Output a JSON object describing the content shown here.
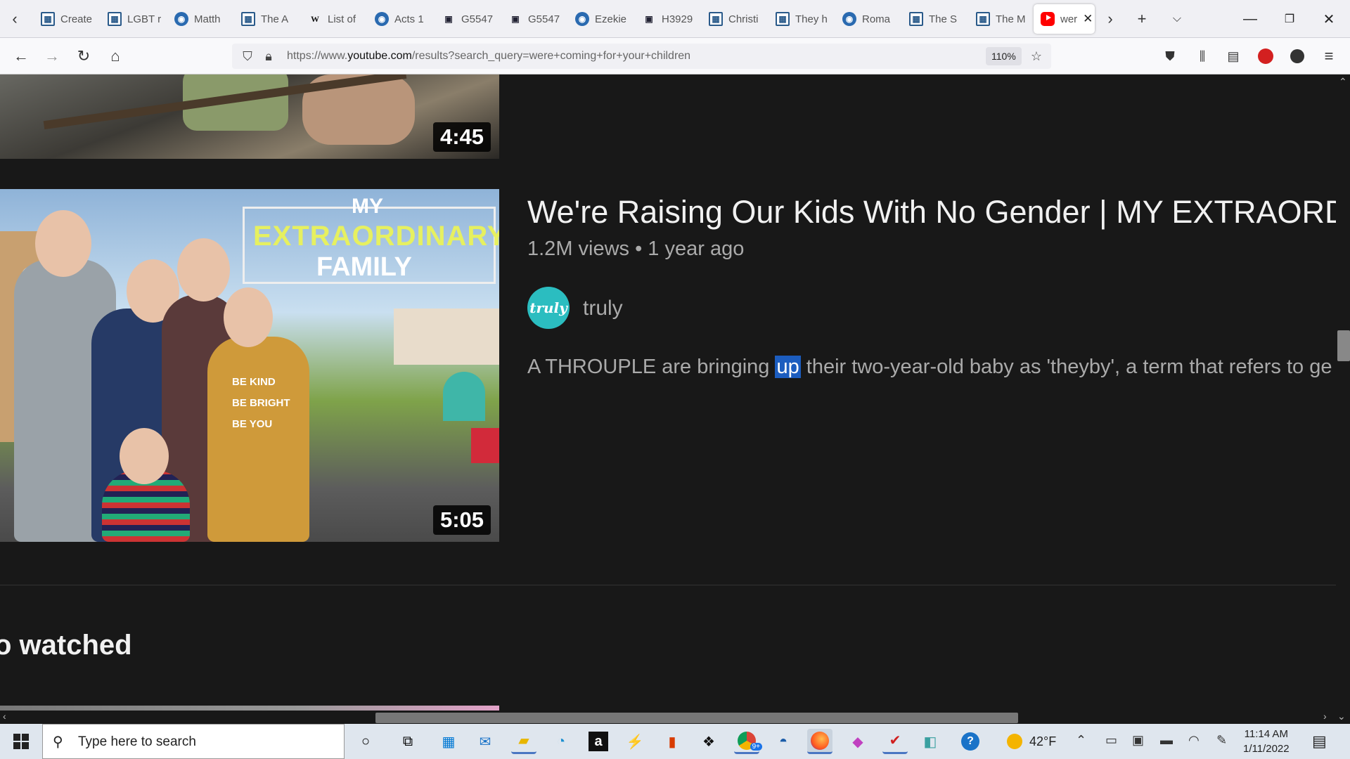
{
  "browser": {
    "tabs": [
      {
        "title": "Create",
        "icon": "grid"
      },
      {
        "title": "LGBT r",
        "icon": "grid"
      },
      {
        "title": "Matth",
        "icon": "globe"
      },
      {
        "title": "The A",
        "icon": "grid"
      },
      {
        "title": "List of",
        "icon": "w"
      },
      {
        "title": "Acts 1",
        "icon": "globe"
      },
      {
        "title": "G5547",
        "icon": "book"
      },
      {
        "title": "G5547",
        "icon": "book"
      },
      {
        "title": "Ezekie",
        "icon": "globe"
      },
      {
        "title": "H3929",
        "icon": "book"
      },
      {
        "title": "Christi",
        "icon": "grid"
      },
      {
        "title": "They h",
        "icon": "grid"
      },
      {
        "title": "Roma",
        "icon": "globe"
      },
      {
        "title": "The S",
        "icon": "grid"
      },
      {
        "title": "The M",
        "icon": "grid"
      },
      {
        "title": "wer",
        "icon": "youtube"
      }
    ],
    "url_prefix": "https://www.",
    "url_host": "youtube.com",
    "url_path": "/results?search_query=were+coming+for+your+children",
    "zoom": "110%"
  },
  "content": {
    "video1": {
      "duration": "4:45"
    },
    "video2": {
      "thumbnail_text_1": "MY",
      "thumbnail_text_2": "EXTRAORDINARY",
      "thumbnail_text_3": "FAMILY",
      "shirt_text_1": "BE KIND",
      "shirt_text_2": "BE BRIGHT",
      "shirt_text_3": "BE YOU",
      "duration": "5:05",
      "title": "We're Raising Our Kids With No Gender | MY EXTRAORDIN",
      "meta": "1.2M views • 1 year ago",
      "channel_avatar_text": "truly",
      "channel": "truly",
      "desc_before": "A THROUPLE are bringing ",
      "desc_highlight": "up",
      "desc_after": " their two-year-old baby as 'theyby', a term that refers to ge"
    },
    "section_title": "o watched"
  },
  "taskbar": {
    "search_placeholder": "Type here to search",
    "weather": "42°F",
    "time": "11:14 AM",
    "date": "1/11/2022",
    "badge_count": "9+"
  },
  "colors": {
    "page_bg": "#181818",
    "highlight": "#1c5dbf",
    "channel_avatar": "#2bbdc0",
    "thumbnail_headline": "#e6f060"
  }
}
